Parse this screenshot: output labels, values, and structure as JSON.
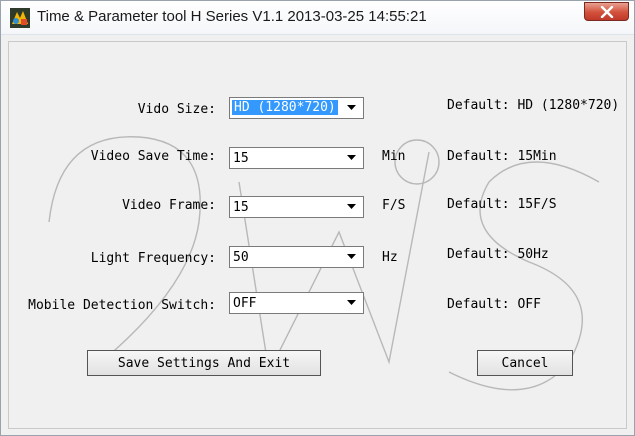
{
  "window": {
    "title": "Time & Parameter tool H Series V1.1 2013-03-25 14:55:21",
    "app_icon": "app-icon",
    "close_icon": "close-icon"
  },
  "colors": {
    "selection": "#3399ff",
    "close_button": "#c0392b"
  },
  "fields": [
    {
      "label": "Vido Size:",
      "value": "HD (1280*720)",
      "unit": "",
      "default": "Default: HD (1280*720)"
    },
    {
      "label": "Video Save Time:",
      "value": "15",
      "unit": "Min",
      "default": "Default: 15Min"
    },
    {
      "label": "Video Frame:",
      "value": "15",
      "unit": "F/S",
      "default": "Default: 15F/S"
    },
    {
      "label": "Light Frequency:",
      "value": "50",
      "unit": "Hz",
      "default": "Default: 50Hz"
    },
    {
      "label": "Mobile Detection Switch:",
      "value": "OFF",
      "unit": "",
      "default": "Default: OFF"
    }
  ],
  "buttons": {
    "save": "Save Settings And Exit",
    "cancel": "Cancel"
  }
}
